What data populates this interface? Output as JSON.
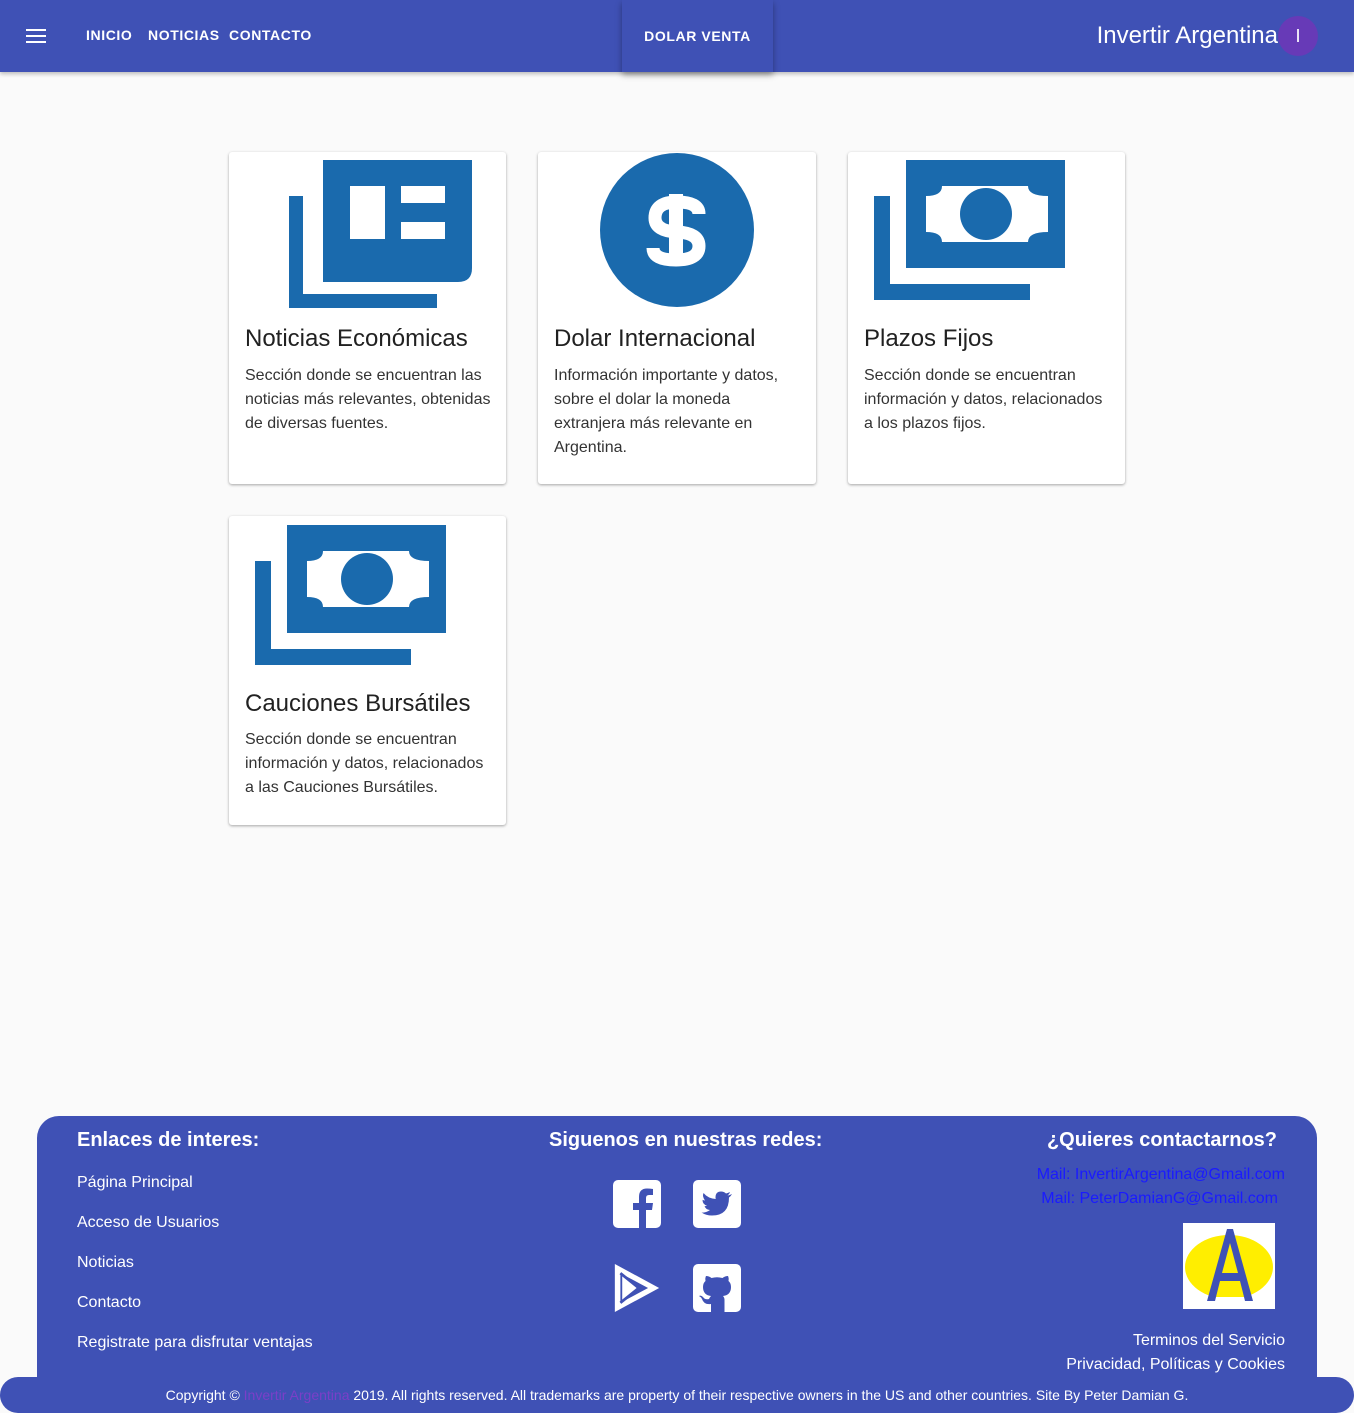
{
  "header": {
    "nav": [
      "INICIO",
      "NOTICIAS",
      "CONTACTO"
    ],
    "dolar_button": "DOLAR VENTA",
    "brand": "Invertir Argentina",
    "avatar_initial": "I",
    "color": "#3f51b5"
  },
  "cards": [
    {
      "title": "Noticias Económicas",
      "text": "Sección donde se encuentran las noticias más relevantes, obtenidas de diversas fuentes.",
      "icon": "newspaper-icon"
    },
    {
      "title": "Dolar Internacional",
      "text": "Información importante y datos, sobre el dolar la moneda extranjera más relevante en Argentina.",
      "icon": "dollar-coin-icon"
    },
    {
      "title": "Plazos Fijos",
      "text": "Sección donde se encuentran información y datos, relacionados a los plazos fijos.",
      "icon": "money-bills-icon"
    },
    {
      "title": "Cauciones Bursátiles",
      "text": "Sección donde se encuentran información y datos, relacionados a las Cauciones Bursátiles.",
      "icon": "money-bills-icon"
    }
  ],
  "footer": {
    "links_title": "Enlaces de interes:",
    "links": [
      "Página Principal",
      "Acceso de Usuarios",
      "Noticias",
      "Contacto",
      "Registrate para disfrutar ventajas"
    ],
    "social_title": "Siguenos en nuestras redes:",
    "social_icons": [
      "facebook-icon",
      "twitter-icon",
      "google-play-icon",
      "github-icon"
    ],
    "contact_title": "¿Quieres contactarnos?",
    "mails": [
      "Mail: InvertirArgentina@Gmail.com",
      "Mail: PeterDamianG@Gmail.com"
    ],
    "legal": [
      "Terminos del Servicio",
      "Privacidad, Políticas y Cookies"
    ]
  },
  "copyright": {
    "prefix": "Copyright © ",
    "brand": "Invertir Argentina",
    "suffix": " 2019. All rights reserved. All trademarks are property of their respective owners in the US and other countries. Site By Peter Damian G."
  },
  "icon_color": "#1a6aad"
}
